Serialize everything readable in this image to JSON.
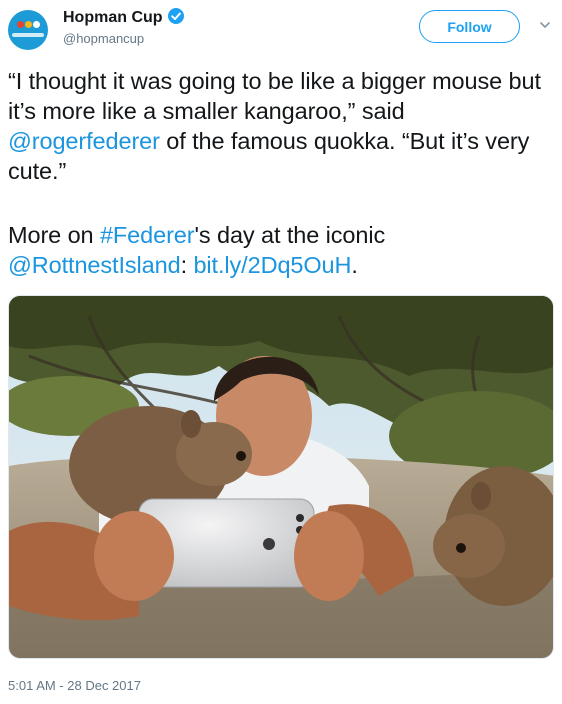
{
  "account": {
    "display_name": "Hopman Cup",
    "handle": "@hopmancup",
    "verified_icon": "verified-badge-icon",
    "avatar_icon": "hopman-cup-logo"
  },
  "actions": {
    "follow_label": "Follow",
    "more_icon": "chevron-down-icon"
  },
  "tweet": {
    "line1_part1": "“I thought it was going to be like a bigger mouse but it’s more like a smaller kangaroo,” said ",
    "mention1": "@rogerfederer",
    "line1_part2": " of the famous quokka. “But it’s very cute.”",
    "line2_part1": "More on ",
    "hashtag": "#Federer",
    "line2_part2": "'s day at the iconic ",
    "mention2": "@RottnestIsland",
    "line2_part3": ": ",
    "url": "bit.ly/2Dq5OuH",
    "line2_part4": "."
  },
  "media": {
    "photo_icon": "quokka-selfie-photo"
  },
  "timestamp": "5:01 AM - 28 Dec 2017",
  "colors": {
    "link": "#1b95e0",
    "follow_border": "#1da1f2",
    "secondary_text": "#657786",
    "avatar_bg": "#1d9bd6"
  }
}
